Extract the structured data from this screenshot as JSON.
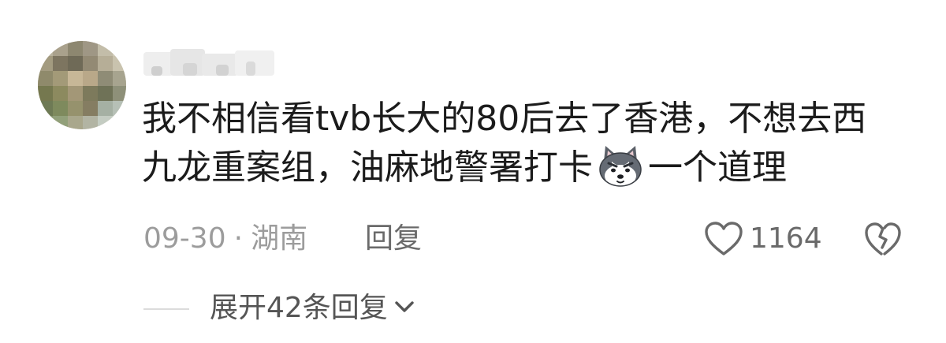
{
  "comment": {
    "text_line_1": "我不相信看tvb长大的80后去了香港，不想去西",
    "text_line_2_before_emoji": "九龙重案组，油麻地警署打卡",
    "text_line_2_after_emoji": "一个道理",
    "emoji_icon": "husky-dog-emoji-icon",
    "date": "09-30",
    "separator": "·",
    "location": "湖南",
    "reply_label": "回复",
    "like_icon": "heart-outline-icon",
    "like_count": "1164",
    "dislike_icon": "broken-heart-icon"
  },
  "replies": {
    "expand_label": "展开42条回复",
    "chevron_icon": "chevron-down-icon"
  },
  "colors": {
    "text_primary": "#1b1b1b",
    "text_meta": "#9c9c9c",
    "text_secondary": "#6a6a6a",
    "divider": "#dcdcdc"
  }
}
